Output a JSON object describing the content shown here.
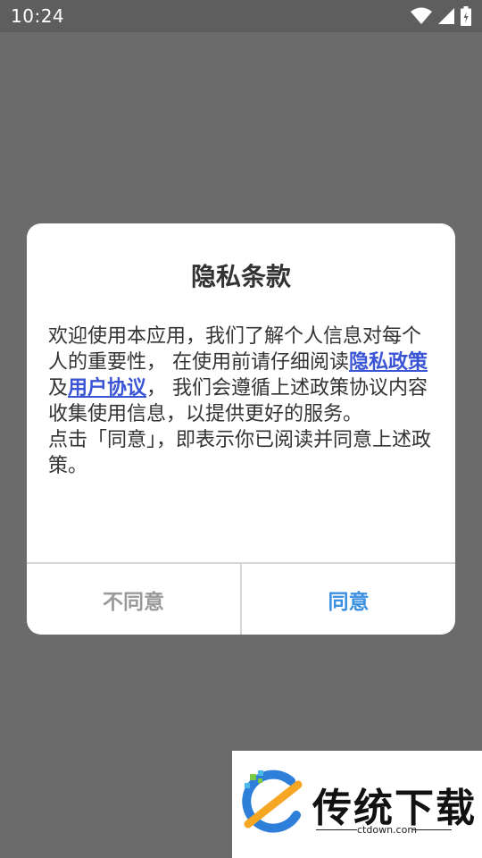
{
  "status_bar": {
    "time": "10:24",
    "icons": [
      "wifi-icon",
      "signal-icon",
      "battery-icon"
    ]
  },
  "dialog": {
    "title": "隐私条款",
    "body": {
      "intro": "欢迎使用本应用，我们了解个人信息对每个人的重要性， 在使用前请仔细阅读",
      "privacy_link": "隐私政策",
      "conjunction": "及",
      "user_link": "用户协议",
      "after_links": "， 我们会遵循上述政策协议内容收集使用信息，以提供更好的服务。",
      "second_paragraph": "点击「同意」，即表示你已阅读并同意上述政策。"
    },
    "buttons": {
      "disagree": "不同意",
      "agree": "同意"
    }
  },
  "colors": {
    "overlay": "#6b6b6b",
    "link": "#3a54d6",
    "agree": "#3a8fe0",
    "disagree": "#999999"
  },
  "watermark": {
    "brand": "传统下载",
    "domain": "ctdown.com"
  }
}
